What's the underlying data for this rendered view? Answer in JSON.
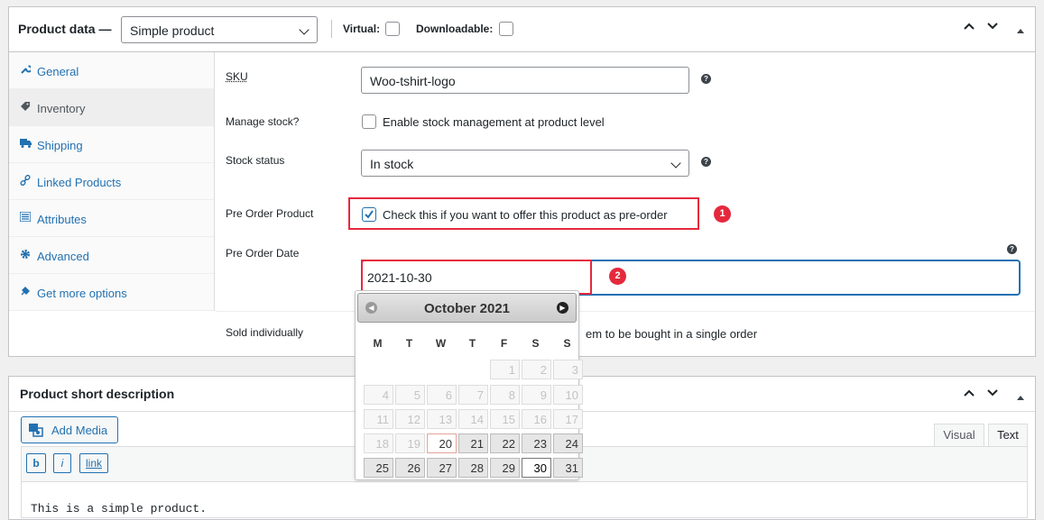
{
  "product_data": {
    "title": "Product data —",
    "type_select": "Simple product",
    "virtual_label": "Virtual:",
    "downloadable_label": "Downloadable:",
    "tabs": [
      {
        "label": "General",
        "icon": "wrench-icon"
      },
      {
        "label": "Inventory",
        "icon": "tag-icon"
      },
      {
        "label": "Shipping",
        "icon": "truck-icon"
      },
      {
        "label": "Linked Products",
        "icon": "link-icon"
      },
      {
        "label": "Attributes",
        "icon": "list-icon"
      },
      {
        "label": "Advanced",
        "icon": "gear-icon"
      },
      {
        "label": "Get more options",
        "icon": "plugin-icon"
      }
    ],
    "fields": {
      "sku_label": "SKU",
      "sku_value": "Woo-tshirt-logo",
      "manage_stock_label": "Manage stock?",
      "manage_stock_text": "Enable stock management at product level",
      "stock_status_label": "Stock status",
      "stock_status_value": "In stock",
      "pre_order_label": "Pre Order Product",
      "pre_order_text": "Check this if you want to offer this product as pre-order",
      "pre_order_date_label": "Pre Order Date",
      "pre_order_date_value": "2021-10-30",
      "sold_individually_label": "Sold individually",
      "sold_individually_text": "em to be bought in a single order"
    },
    "badges": [
      "1",
      "2"
    ]
  },
  "calendar": {
    "month_title": "October 2021",
    "weekdays": [
      "M",
      "T",
      "W",
      "T",
      "F",
      "S",
      "S"
    ],
    "weeks": [
      [
        "",
        "",
        "",
        "",
        "1",
        "2",
        "3"
      ],
      [
        "4",
        "5",
        "6",
        "7",
        "8",
        "9",
        "10"
      ],
      [
        "11",
        "12",
        "13",
        "14",
        "15",
        "16",
        "17"
      ],
      [
        "18",
        "19",
        "20",
        "21",
        "22",
        "23",
        "24"
      ],
      [
        "25",
        "26",
        "27",
        "28",
        "29",
        "30",
        "31"
      ]
    ],
    "today": "20",
    "selected": "30"
  },
  "short_description": {
    "title": "Product short description",
    "add_media": "Add Media",
    "tab_visual": "Visual",
    "tab_text": "Text",
    "quicktags": [
      "b",
      "i",
      "link"
    ],
    "content": "This is a simple product."
  },
  "colors": {
    "accent": "#2271b1",
    "highlight_red": "#e5293d"
  }
}
